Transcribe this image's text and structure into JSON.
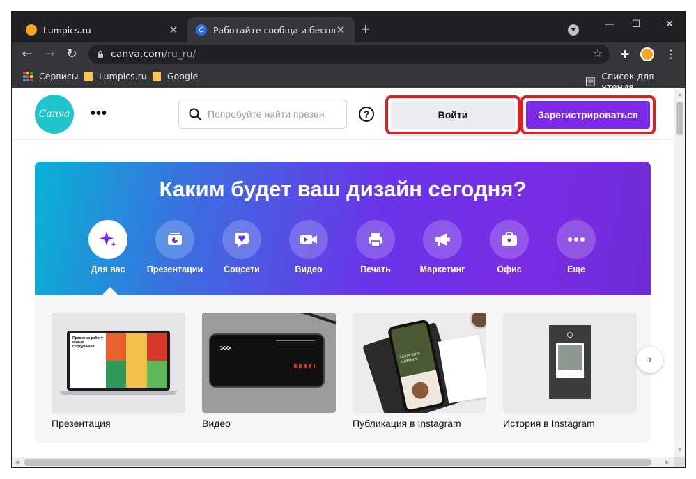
{
  "browser": {
    "tabs": [
      {
        "title": "Lumpics.ru",
        "active": false
      },
      {
        "title": "Работайте сообща и бесплатно",
        "active": true
      }
    ],
    "url_host": "canva.com",
    "url_path": "/ru_ru/",
    "bookmarks": [
      "Сервисы",
      "Lumpics.ru",
      "Google"
    ],
    "reading_list": "Список для чтения"
  },
  "canva": {
    "logo_text": "Canva",
    "search_placeholder": "Попробуйте найти презен",
    "login_label": "Войти",
    "signup_label": "Зарегистрироваться",
    "hero_title": "Каким будет ваш дизайн сегодня?",
    "categories": [
      {
        "label": "Для вас",
        "icon": "sparkle-icon"
      },
      {
        "label": "Презентации",
        "icon": "presentation-icon"
      },
      {
        "label": "Соцсети",
        "icon": "heart-icon"
      },
      {
        "label": "Видео",
        "icon": "video-camera-icon"
      },
      {
        "label": "Печать",
        "icon": "printer-icon"
      },
      {
        "label": "Маркетинг",
        "icon": "megaphone-icon"
      },
      {
        "label": "Офис",
        "icon": "briefcase-icon"
      },
      {
        "label": "Еще",
        "icon": "more-icon"
      }
    ],
    "cards": [
      {
        "caption": "Презентация"
      },
      {
        "caption": "Видео"
      },
      {
        "caption": "Публикация в Instagram"
      },
      {
        "caption": "История в Instagram"
      }
    ],
    "thumb_texts": {
      "presentation": "Правки на работу новых сотрудников",
      "instagram_post": "Закуска и подарок"
    }
  },
  "colors": {
    "brand_purple": "#7d2ae8",
    "logo_teal": "#20c4cb",
    "highlight_red": "#e11d1d"
  }
}
